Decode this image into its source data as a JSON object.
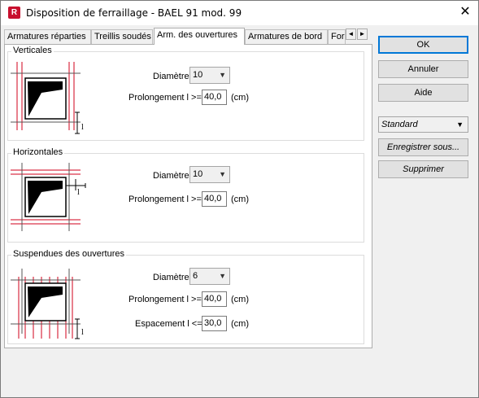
{
  "window": {
    "title": "Disposition de ferraillage - BAEL 91 mod. 99",
    "close_glyph": "✕",
    "app_icon_letter": "R"
  },
  "tabs": [
    {
      "label": "Armatures réparties"
    },
    {
      "label": "Treillis soudés"
    },
    {
      "label": "Arm. des ouvertures"
    },
    {
      "label": "Armatures de bord"
    },
    {
      "label": "For"
    }
  ],
  "tab_scroll": {
    "left": "◄",
    "right": "►"
  },
  "groups": {
    "verticales": {
      "title": "Verticales",
      "diametre_label": "Diamètre",
      "diametre_value": "10",
      "prolongement_label": "Prolongement l >=",
      "prolongement_value": "40,0",
      "prolongement_unit": "(cm)"
    },
    "horizontales": {
      "title": "Horizontales",
      "diametre_label": "Diamètre",
      "diametre_value": "10",
      "prolongement_label": "Prolongement l >=",
      "prolongement_value": "40,0",
      "prolongement_unit": "(cm)"
    },
    "suspendues": {
      "title": "Suspendues des ouvertures",
      "diametre_label": "Diamètre",
      "diametre_value": "6",
      "prolongement_label": "Prolongement l >=",
      "prolongement_value": "40,0",
      "prolongement_unit": "(cm)",
      "espacement_label": "Espacement l <=",
      "espacement_value": "30,0",
      "espacement_unit": "(cm)"
    }
  },
  "diagram_mark": "l",
  "buttons": {
    "ok": "OK",
    "annuler": "Annuler",
    "aide": "Aide",
    "enregistrer": "Enregistrer sous...",
    "supprimer": "Supprimer"
  },
  "preset": {
    "value": "Standard"
  },
  "colors": {
    "accent": "#0078d7",
    "rebar": "#d0021b",
    "app_icon": "#c8102e"
  }
}
